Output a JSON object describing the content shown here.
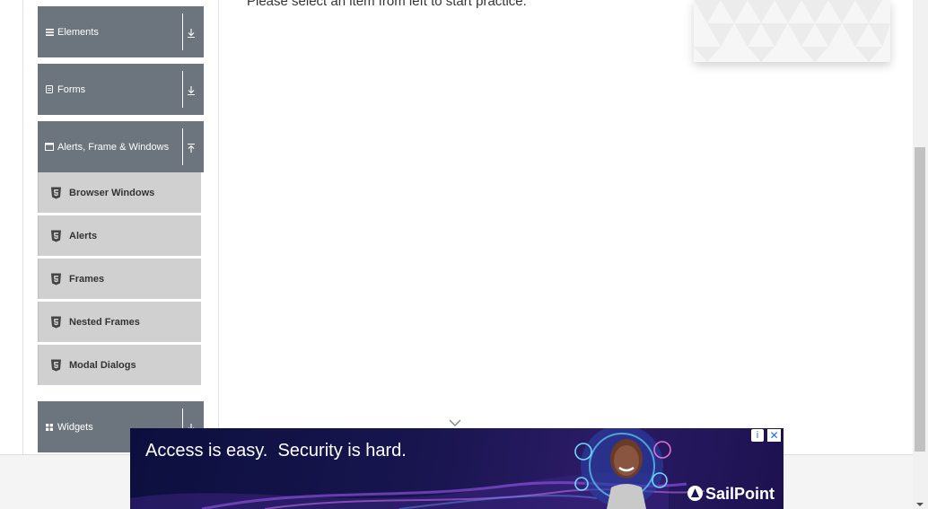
{
  "main": {
    "intro_text": "Please select an item from left to start practice."
  },
  "sidebar": {
    "groups": [
      {
        "label": "Elements",
        "icon": "list-icon",
        "arrow": "download-icon"
      },
      {
        "label": "Forms",
        "icon": "file-icon",
        "arrow": "download-icon"
      },
      {
        "label": "Alerts, Frame & Windows",
        "icon": "window-icon",
        "arrow": "upload-icon"
      },
      {
        "label": "Widgets",
        "icon": "grid-icon",
        "arrow": "download-icon"
      }
    ],
    "items": [
      {
        "label": "Browser Windows",
        "icon": "html5-icon"
      },
      {
        "label": "Alerts",
        "icon": "html5-icon"
      },
      {
        "label": "Frames",
        "icon": "html5-icon"
      },
      {
        "label": "Nested Frames",
        "icon": "html5-icon"
      },
      {
        "label": "Modal Dialogs",
        "icon": "html5-icon"
      }
    ]
  },
  "ad": {
    "headline": "Access is easy.  Security is hard.",
    "brand": "SailPoint",
    "info_symbol": "i",
    "close_symbol": "✕"
  },
  "colors": {
    "group_header_bg": "#6c757d",
    "menu_item_bg": "#d0d0d0",
    "ad_bg": "#18154f"
  }
}
